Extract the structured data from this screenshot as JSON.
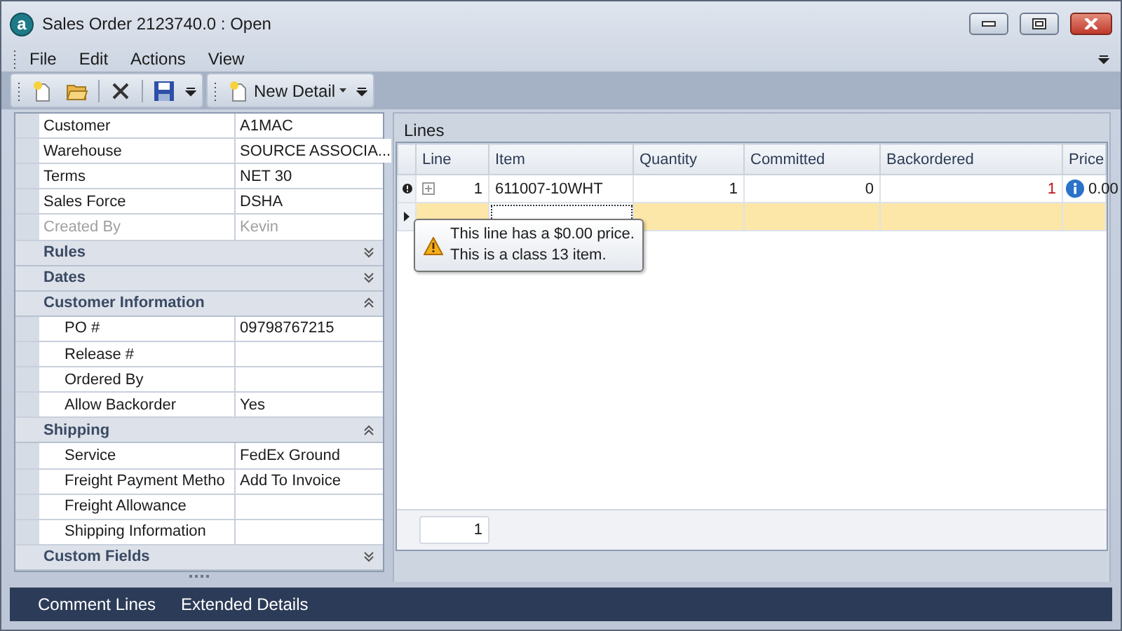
{
  "window": {
    "logo": "a",
    "title": "Sales Order 2123740.0 : Open"
  },
  "menu": [
    {
      "label": "File"
    },
    {
      "label": "Edit"
    },
    {
      "label": "Actions"
    },
    {
      "label": "View"
    }
  ],
  "toolbar": [
    {
      "kind": "new"
    },
    {
      "kind": "open"
    },
    {
      "kind": "separator"
    },
    {
      "kind": "delete"
    },
    {
      "kind": "separator"
    },
    {
      "kind": "save"
    },
    {
      "kind": "overflow"
    },
    {
      "kind": "grip"
    },
    {
      "kind": "new-detail",
      "label": "New Detail"
    },
    {
      "kind": "overflow"
    }
  ],
  "properties": {
    "fields": [
      {
        "label": "Customer",
        "value": "A1MAC",
        "disabled": false
      },
      {
        "label": "Warehouse",
        "value": "SOURCE ASSOCIA...",
        "disabled": false
      },
      {
        "label": "Terms",
        "value": "NET 30",
        "disabled": false
      },
      {
        "label": "Sales Force",
        "value": "DSHA",
        "disabled": false
      },
      {
        "label": "Created By",
        "value": "Kevin",
        "disabled": true
      }
    ],
    "sections": [
      {
        "title": "Rules",
        "expanded": false
      },
      {
        "title": "Dates",
        "expanded": false
      },
      {
        "title": "Customer Information",
        "expanded": true,
        "fields": [
          {
            "label": "PO #",
            "value": "09798767215",
            "disabled": false
          },
          {
            "label": "Release #",
            "disabled": false
          },
          {
            "label": "Ordered By",
            "disabled": false
          },
          {
            "label": "Allow Backorder",
            "value": "Yes",
            "disabled": false
          }
        ]
      },
      {
        "title": "Shipping",
        "expanded": true,
        "fields": [
          {
            "label": "Service",
            "value": "FedEx Ground",
            "disabled": false
          },
          {
            "label": "Freight Payment Metho",
            "value": "Add To Invoice",
            "disabled": false
          },
          {
            "label": "Freight Allowance",
            "disabled": false
          },
          {
            "label": "Shipping Information",
            "disabled": false
          }
        ]
      },
      {
        "title": "Custom Fields",
        "expanded": false
      }
    ]
  },
  "lines": {
    "title": "Lines",
    "columns": [
      "Line",
      "Item",
      "Quantity",
      "Committed",
      "Backordered",
      "Price"
    ],
    "rows": [
      {
        "error": true,
        "expandable": true,
        "selected": false,
        "line": "1",
        "item": "611007-10WHT",
        "quantity": "1",
        "committed": "0",
        "backordered": "1",
        "backordered_alert": true,
        "price_info": true,
        "price": "0.00"
      },
      {
        "error": false,
        "expandable": false,
        "selected": true
      }
    ],
    "tooltip": {
      "kind": "warning",
      "lines": [
        "This line has a $0.00 price.",
        "This is a class 13 item."
      ]
    },
    "footer_count": "1"
  },
  "bottom_tabs": [
    "Comment Lines",
    "Extended Details"
  ]
}
